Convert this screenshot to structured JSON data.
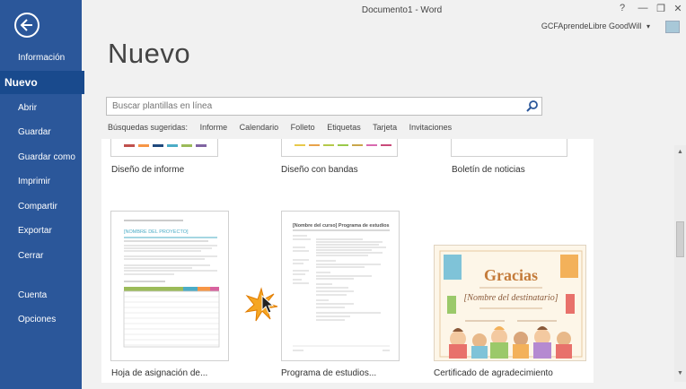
{
  "window": {
    "title": "Documento1 - Word",
    "help": "?",
    "minimize": "—",
    "restore": "❐",
    "close": "✕"
  },
  "account": {
    "name": "GCFAprendeLibre GoodWill",
    "dropdown": "▾"
  },
  "sidebar": {
    "items": [
      {
        "label": "Información"
      },
      {
        "label": "Nuevo"
      },
      {
        "label": "Abrir"
      },
      {
        "label": "Guardar"
      },
      {
        "label": "Guardar como"
      },
      {
        "label": "Imprimir"
      },
      {
        "label": "Compartir"
      },
      {
        "label": "Exportar"
      },
      {
        "label": "Cerrar"
      },
      {
        "label": "Cuenta"
      },
      {
        "label": "Opciones"
      }
    ],
    "active_index": 1
  },
  "page": {
    "title": "Nuevo"
  },
  "search": {
    "placeholder": "Buscar plantillas en línea",
    "value": ""
  },
  "suggested": {
    "label": "Búsquedas sugeridas:",
    "terms": [
      "Informe",
      "Calendario",
      "Folleto",
      "Etiquetas",
      "Tarjeta",
      "Invitaciones"
    ]
  },
  "templates": [
    {
      "name": "Diseño de informe"
    },
    {
      "name": "Diseño con bandas"
    },
    {
      "name": "Boletín de noticias"
    },
    {
      "name": "Hoja de asignación de..."
    },
    {
      "name": "Programa de estudios..."
    },
    {
      "name": "Certificado de agradecimiento"
    }
  ],
  "thumbnails": {
    "project": {
      "heading": "[NOMBRE DEL PROYECTO]"
    },
    "syllabus": {
      "heading": "[Nombre del curso] Programa de estudios"
    },
    "certificate": {
      "title": "Gracias",
      "recipient": "[Nombre del destinatario]"
    }
  },
  "colors": {
    "sidebar": "#2b579a",
    "active_nav": "#194a8d",
    "background": "#f1f1f1"
  },
  "icons": {
    "back": "arrow-left-icon",
    "search": "search-icon"
  }
}
